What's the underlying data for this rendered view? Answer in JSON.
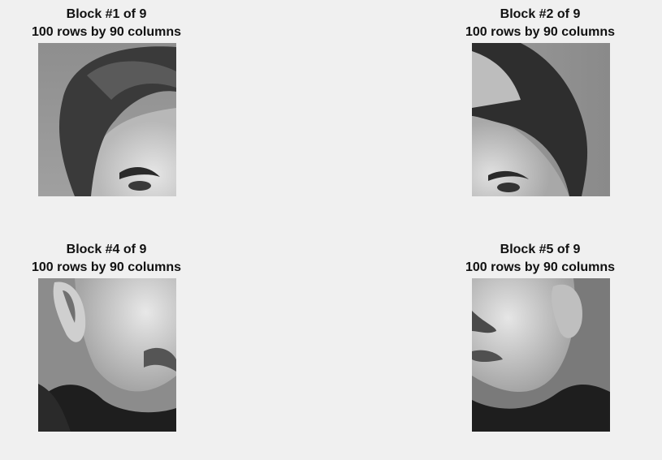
{
  "panels": [
    {
      "title": "Block #1 of 9",
      "subtitle": "100 rows by 90 columns",
      "image_content": "top-left face block: hair and forehead"
    },
    {
      "title": "Block #2 of 9",
      "subtitle": "100 rows by 90 columns",
      "image_content": "top-middle face block: hair and forehead"
    },
    {
      "title": "Block #4 of 9",
      "subtitle": "100 rows by 90 columns",
      "image_content": "middle-left face block: ear, cheek, jaw"
    },
    {
      "title": "Block #5 of 9",
      "subtitle": "100 rows by 90 columns",
      "image_content": "middle-center face block: nose, mouth, chin"
    }
  ]
}
